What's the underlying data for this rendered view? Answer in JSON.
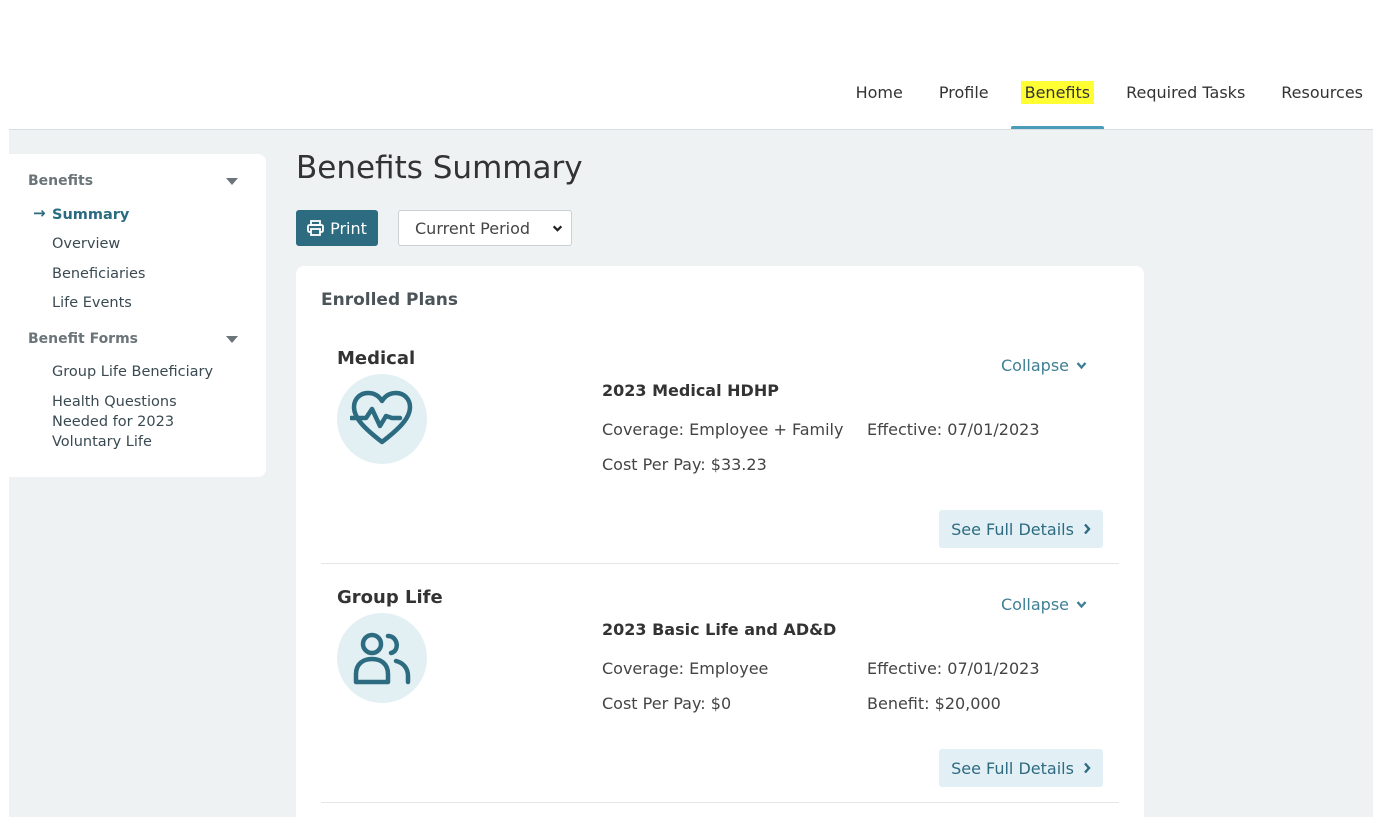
{
  "nav": {
    "items": [
      {
        "label": "Home",
        "active": false
      },
      {
        "label": "Profile",
        "active": false
      },
      {
        "label": "Benefits",
        "active": true
      },
      {
        "label": "Required Tasks",
        "active": false
      },
      {
        "label": "Resources",
        "active": false
      }
    ]
  },
  "sidebar": {
    "sections": [
      {
        "label": "Benefits",
        "items": [
          "Summary",
          "Overview",
          "Beneficiaries",
          "Life Events"
        ]
      },
      {
        "label": "Benefit Forms",
        "items": [
          "Group Life Beneficiary",
          "Health Questions Needed for 2023 Voluntary Life"
        ]
      }
    ],
    "active_item": "Summary"
  },
  "page": {
    "title": "Benefits Summary",
    "print_label": "Print",
    "period_value": "Current Period"
  },
  "card": {
    "title": "Enrolled Plans",
    "plans": [
      {
        "name": "Medical",
        "icon": "heart-pulse-icon",
        "collapse_label": "Collapse",
        "plan_title": "2023 Medical HDHP",
        "coverage": "Coverage: Employee + Family",
        "effective": "Effective: 07/01/2023",
        "cost": "Cost Per Pay: $33.23",
        "benefit": "",
        "details_label": "See Full Details"
      },
      {
        "name": "Group Life",
        "icon": "people-icon",
        "collapse_label": "Collapse",
        "plan_title": "2023 Basic Life and AD&D",
        "coverage": "Coverage: Employee",
        "effective": "Effective: 07/01/2023",
        "cost": "Cost Per Pay: $0",
        "benefit": "Benefit: $20,000",
        "details_label": "See Full Details"
      }
    ]
  },
  "colors": {
    "accent": "#2c6b80",
    "highlight": "#ffff33",
    "background": "#eef2f3"
  }
}
